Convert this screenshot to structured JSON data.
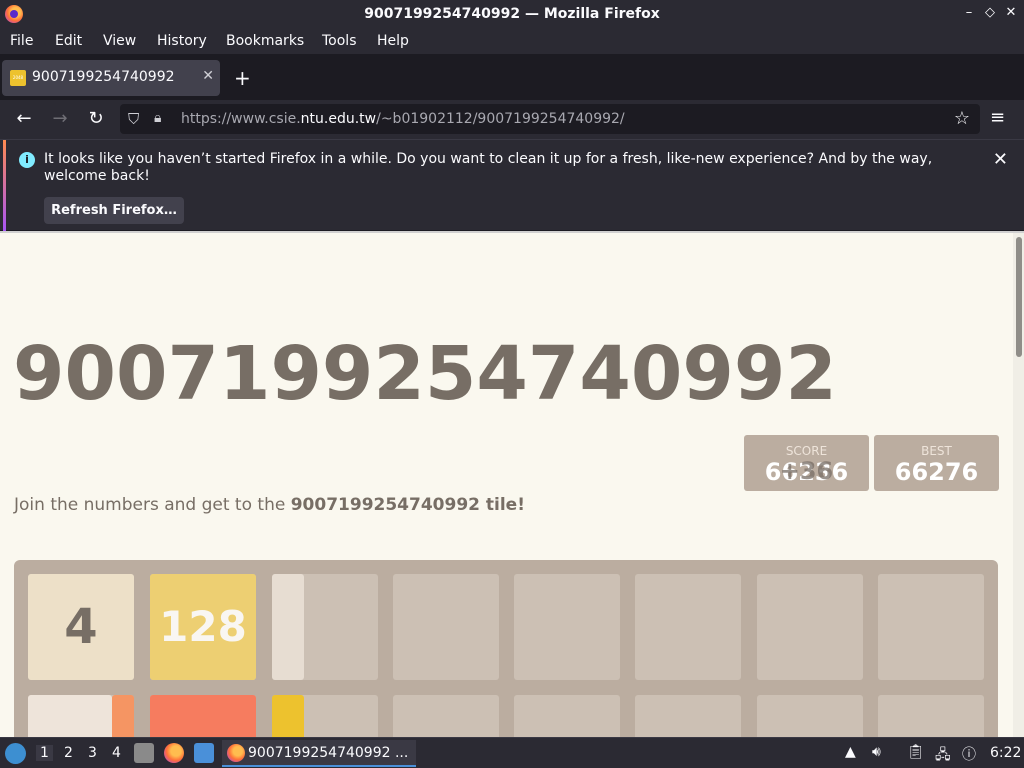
{
  "window": {
    "title": "9007199254740992 — Mozilla Firefox",
    "controls": [
      "–",
      "◇",
      "✕"
    ]
  },
  "menu": [
    "File",
    "Edit",
    "View",
    "History",
    "Bookmarks",
    "Tools",
    "Help"
  ],
  "tab": {
    "favicon_text": "2048",
    "title": "9007199254740992",
    "close": "✕",
    "new_tab": "+"
  },
  "nav": {
    "back": "←",
    "forward": "→",
    "reload": "↻",
    "url_prefix": "https://www.csie.",
    "url_host": "ntu.edu.tw",
    "url_path": "/~b01902112/9007199254740992/",
    "bookmark_star": "☆",
    "menu_icon": "≡"
  },
  "notification": {
    "message": "It looks like you haven’t started Firefox in a while. Do you want to clean it up for a fresh, like-new experience? And by the way, welcome back!",
    "button": "Refresh Firefox…",
    "info": "i",
    "close": "✕"
  },
  "game": {
    "title": "9007199254740992",
    "score_label": "SCORE",
    "score_value": "66236",
    "score_addition": "+36",
    "best_label": "BEST",
    "best_value": "66276",
    "intro_prefix": "Join the numbers and get to the ",
    "intro_bold": "9007199254740992 tile!",
    "tiles": [
      {
        "value": "4",
        "row": 0,
        "col": 0
      },
      {
        "value": "128",
        "row": 0,
        "col": 1
      }
    ]
  },
  "taskbar": {
    "workspaces": [
      "1",
      "2",
      "3",
      "4"
    ],
    "app_label": "9007199254740992 ...",
    "clock": "6:22"
  },
  "colors": {
    "page_bg": "#faf8ef",
    "board": "#bbada0",
    "tile_4": "#ede0c8",
    "tile_128": "#edcf72",
    "title_text": "#776e65"
  }
}
